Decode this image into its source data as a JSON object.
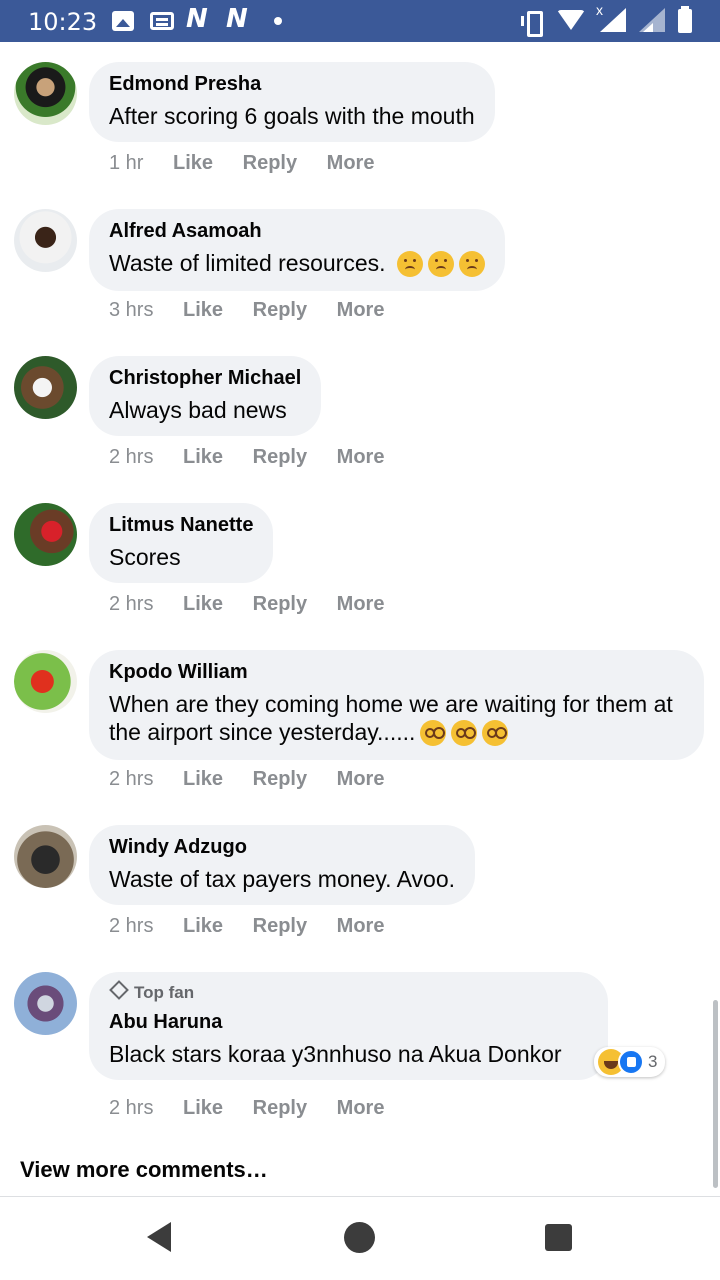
{
  "status_bar": {
    "time": "10:23",
    "icons": [
      "gallery-icon",
      "news-icon",
      "n-icon",
      "n-icon",
      "dot-icon",
      "vibrate-icon",
      "wifi-icon",
      "signal-icon",
      "signal-icon",
      "battery-icon"
    ],
    "signal_x": "x"
  },
  "comments": [
    {
      "author": "Edmond Presha",
      "text": "After scoring 6 goals with the mouth",
      "time": "1 hr",
      "like": "Like",
      "reply": "Reply",
      "more": "More"
    },
    {
      "author": "Alfred Asamoah",
      "text": "Waste of limited resources.",
      "emojis": [
        "sad",
        "sad",
        "sad"
      ],
      "time": "3 hrs",
      "like": "Like",
      "reply": "Reply",
      "more": "More"
    },
    {
      "author": "Christopher Michael",
      "text": "Always bad news",
      "time": "2 hrs",
      "like": "Like",
      "reply": "Reply",
      "more": "More"
    },
    {
      "author": "Litmus Nanette",
      "text": "Scores",
      "time": "2 hrs",
      "like": "Like",
      "reply": "Reply",
      "more": "More"
    },
    {
      "author": "Kpodo William",
      "text": "When are they coming home we are waiting for them at the airport since yesterday......",
      "emojis": [
        "monocle",
        "monocle",
        "monocle"
      ],
      "time": "2 hrs",
      "like": "Like",
      "reply": "Reply",
      "more": "More"
    },
    {
      "author": "Windy Adzugo",
      "text": "Waste of tax payers money. Avoo.",
      "time": "2 hrs",
      "like": "Like",
      "reply": "Reply",
      "more": "More"
    },
    {
      "author": "Abu Haruna",
      "badge": "Top fan",
      "text": "Black stars koraa y3nnhuso na Akua Donkor",
      "reactions": {
        "types": [
          "haha",
          "like"
        ],
        "count": "3"
      },
      "time": "2 hrs",
      "like": "Like",
      "reply": "Reply",
      "more": "More"
    }
  ],
  "view_more": "View more comments…",
  "colors": {
    "status_bar": "#3b5998",
    "bubble": "#f0f2f5",
    "meta_text": "#8a8d91",
    "like_blue": "#1877f2"
  },
  "navbar": [
    "back-icon",
    "home-icon",
    "recents-icon"
  ]
}
